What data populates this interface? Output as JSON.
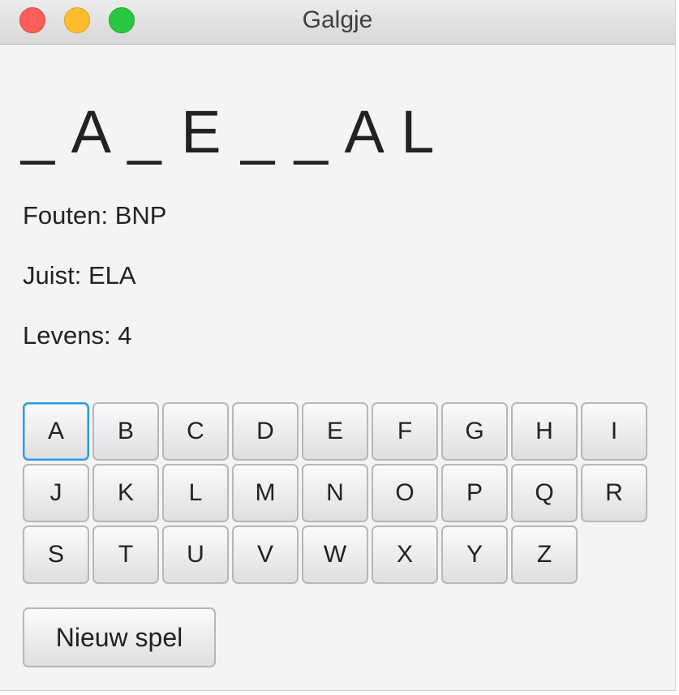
{
  "window": {
    "title": "Galgje"
  },
  "game": {
    "word": "_ A _ E _ _ A L",
    "wrong": "Fouten: BNP",
    "correct": "Juist: ELA",
    "lives": "Levens: 4"
  },
  "keyboard": {
    "keys": [
      "A",
      "B",
      "C",
      "D",
      "E",
      "F",
      "G",
      "H",
      "I",
      "J",
      "K",
      "L",
      "M",
      "N",
      "O",
      "P",
      "Q",
      "R",
      "S",
      "T",
      "U",
      "V",
      "W",
      "X",
      "Y",
      "Z"
    ],
    "focused": "A"
  },
  "new_game_label": "Nieuw spel",
  "colors": {
    "close": "#fc5f57",
    "minimize": "#fdbd2e",
    "maximize": "#27c840",
    "focus": "#2e9adf"
  }
}
